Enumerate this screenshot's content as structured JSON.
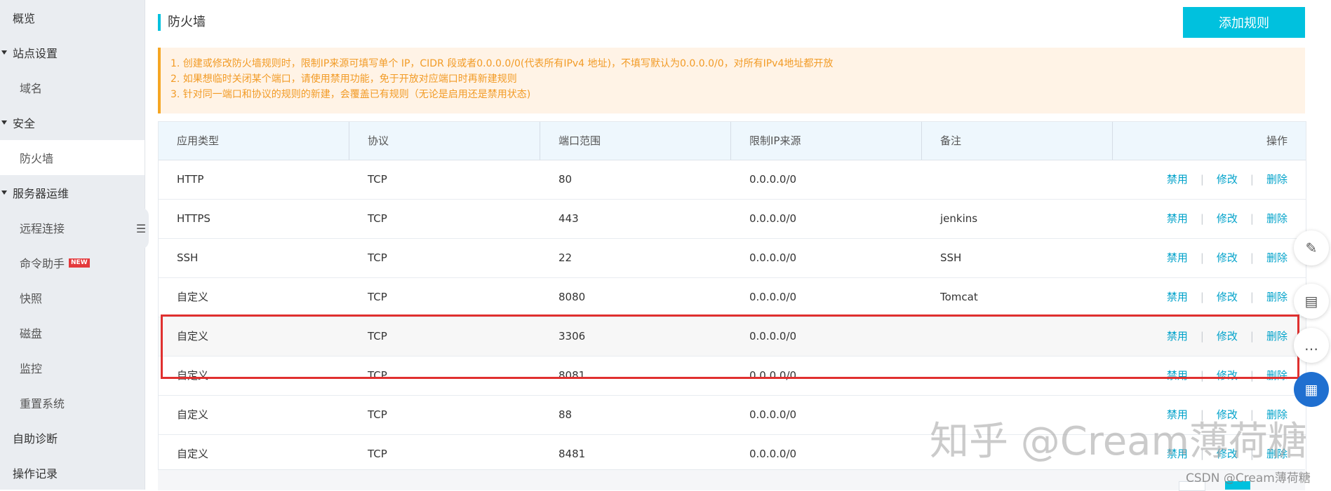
{
  "sidebar": {
    "items": [
      {
        "label": "概览",
        "type": "top"
      },
      {
        "label": "站点设置",
        "type": "group"
      },
      {
        "label": "域名",
        "type": "child"
      },
      {
        "label": "安全",
        "type": "group"
      },
      {
        "label": "防火墙",
        "type": "child",
        "active": true
      },
      {
        "label": "服务器运维",
        "type": "group"
      },
      {
        "label": "远程连接",
        "type": "child"
      },
      {
        "label": "命令助手",
        "type": "child",
        "badge": "NEW"
      },
      {
        "label": "快照",
        "type": "child"
      },
      {
        "label": "磁盘",
        "type": "child"
      },
      {
        "label": "监控",
        "type": "child"
      },
      {
        "label": "重置系统",
        "type": "child"
      },
      {
        "label": "自助诊断",
        "type": "top"
      },
      {
        "label": "操作记录",
        "type": "top"
      }
    ],
    "collapse_icon": "menu-collapse-icon"
  },
  "header": {
    "title": "防火墙",
    "add_button": "添加规则"
  },
  "notice": {
    "lines": [
      "1. 创建或修改防火墙规则时，限制IP来源可填写单个 IP，CIDR 段或者0.0.0.0/0(代表所有IPv4 地址)，不填写默认为0.0.0.0/0，对所有IPv4地址都开放",
      "2. 如果想临时关闭某个端口，请使用禁用功能，免于开放对应端口时再新建规则",
      "3. 针对同一端口和协议的规则的新建，会覆盖已有规则（无论是启用还是禁用状态)"
    ]
  },
  "table": {
    "columns": [
      "应用类型",
      "协议",
      "端口范围",
      "限制IP来源",
      "备注",
      "操作"
    ],
    "actions": {
      "disable": "禁用",
      "edit": "修改",
      "delete": "删除",
      "separator": "|"
    },
    "rows": [
      {
        "type": "HTTP",
        "protocol": "TCP",
        "port": "80",
        "source": "0.0.0.0/0",
        "note": ""
      },
      {
        "type": "HTTPS",
        "protocol": "TCP",
        "port": "443",
        "source": "0.0.0.0/0",
        "note": "jenkins"
      },
      {
        "type": "SSH",
        "protocol": "TCP",
        "port": "22",
        "source": "0.0.0.0/0",
        "note": "SSH"
      },
      {
        "type": "自定义",
        "protocol": "TCP",
        "port": "8080",
        "source": "0.0.0.0/0",
        "note": "Tomcat"
      },
      {
        "type": "自定义",
        "protocol": "TCP",
        "port": "3306",
        "source": "0.0.0.0/0",
        "note": "",
        "highlighted": true
      },
      {
        "type": "自定义",
        "protocol": "TCP",
        "port": "8081",
        "source": "0.0.0.0/0",
        "note": ""
      },
      {
        "type": "自定义",
        "protocol": "TCP",
        "port": "88",
        "source": "0.0.0.0/0",
        "note": ""
      },
      {
        "type": "自定义",
        "protocol": "TCP",
        "port": "8481",
        "source": "0.0.0.0/0",
        "note": ""
      }
    ]
  },
  "floating_tools": [
    {
      "icon": "edit-pen-icon"
    },
    {
      "icon": "book-icon"
    },
    {
      "icon": "chat-icon"
    },
    {
      "icon": "apps-grid-icon"
    }
  ],
  "watermark": {
    "main": "知乎 @Cream薄荷糖",
    "csdn": "CSDN @Cream薄荷糖"
  },
  "colors": {
    "accent": "#00c1de",
    "link": "#00a2ca",
    "notice_text": "#f29b26",
    "notice_bg": "#fff3e6",
    "highlight_border": "#e0302f",
    "sidebar_bg": "#eaedf1"
  }
}
